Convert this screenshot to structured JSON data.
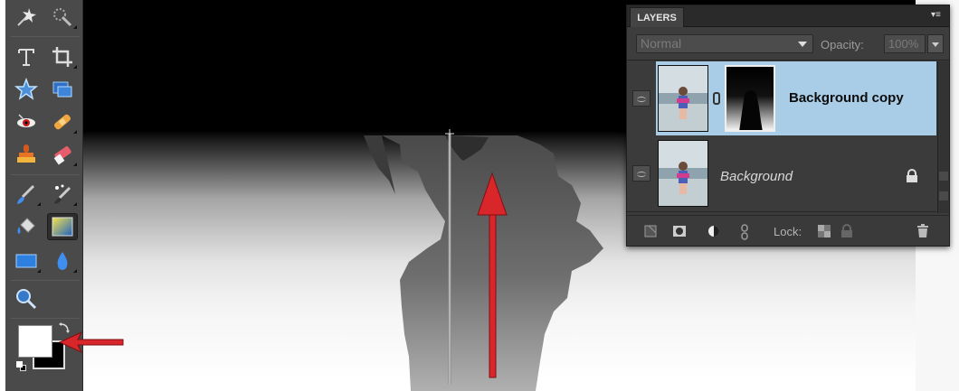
{
  "layers_panel": {
    "tab_label": "LAYERS",
    "menu_icon": "panel-menu-icon",
    "blend_mode": "Normal",
    "opacity_label": "Opacity:",
    "opacity_value": "100%",
    "layers": [
      {
        "name": "Background copy",
        "selected": true,
        "has_mask": true
      },
      {
        "name": "Background",
        "selected": false,
        "locked": true
      }
    ],
    "footer": {
      "lock_label": "Lock:"
    }
  },
  "toolbox": {
    "tools": [
      "magic-wand-icon",
      "quick-selection-icon",
      "type-icon",
      "crop-icon",
      "custom-shape-icon",
      "recompose-icon",
      "red-eye-icon",
      "healing-brush-icon",
      "clone-stamp-icon",
      "eraser-icon",
      "brush-icon",
      "smart-brush-icon",
      "paint-bucket-icon",
      "gradient-icon",
      "rectangle-icon",
      "blur-icon",
      "zoom-icon"
    ],
    "active_tool": "gradient-icon",
    "foreground_color": "#ffffff",
    "background_color": "#000000"
  },
  "colors": {
    "selected_layer": "#a9cde6",
    "annotation_arrow": "#d8262a"
  }
}
